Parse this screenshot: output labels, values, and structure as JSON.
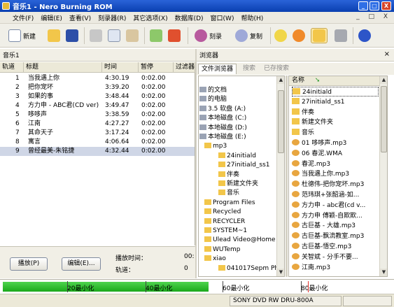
{
  "window": {
    "title": "音乐1 - Nero Burning ROM",
    "controls": [
      "_",
      "□",
      "X"
    ]
  },
  "menu": [
    "文件(F)",
    "编辑(E)",
    "查看(V)",
    "刻录器(R)",
    "其它选项(X)",
    "数据库(D)",
    "窗口(W)",
    "帮助(H)"
  ],
  "mdi_controls": "_ □ X",
  "toolbar": {
    "new_label": "新建",
    "burn_label": "刻录",
    "copy_label": "复制"
  },
  "compilation": {
    "title": "音乐1",
    "columns": [
      "轨道",
      "标题",
      "时间",
      "暂停",
      "过滤器"
    ],
    "tracks": [
      {
        "num": "1",
        "title": "当我遇上你",
        "time": "4:30.19",
        "pause": "0:02.00"
      },
      {
        "num": "2",
        "title": "把你宠坏",
        "time": "3:39.20",
        "pause": "0:02.00"
      },
      {
        "num": "3",
        "title": "如果的事",
        "time": "3:48.44",
        "pause": "0:02.00"
      },
      {
        "num": "4",
        "title": "方力申 - ABC君(CD ver)",
        "time": "3:49.47",
        "pause": "0:02.00"
      },
      {
        "num": "5",
        "title": "哆哆声",
        "time": "3:38.59",
        "pause": "0:02.00"
      },
      {
        "num": "6",
        "title": "江南",
        "time": "4:27.27",
        "pause": "0:02.00"
      },
      {
        "num": "7",
        "title": "其命天子",
        "time": "3:17.24",
        "pause": "0:02.00"
      },
      {
        "num": "8",
        "title": "寓言",
        "time": "4:06.64",
        "pause": "0:02.00"
      },
      {
        "num": "9",
        "title": "曾经最美-朱铭捷",
        "time": "4:32.44",
        "pause": "0:02.00"
      }
    ],
    "play_button": "播放(P)",
    "edit_button": "编辑(E)...",
    "play_time_label": "播放时间：",
    "play_time_value": "00:",
    "track_label": "轨道：",
    "track_value": "0"
  },
  "browser": {
    "title": "浏览器",
    "tabs": [
      "文件浏览器",
      "搜索",
      "已存搜索"
    ],
    "tree": [
      {
        "label": "的文档",
        "indent": 0
      },
      {
        "label": "的电脑",
        "indent": 0
      },
      {
        "label": "3.5 软盘 (A:)",
        "indent": 0
      },
      {
        "label": "本地磁盘 (C:)",
        "indent": 0
      },
      {
        "label": "本地磁盘 (D:)",
        "indent": 0
      },
      {
        "label": "本地磁盘 (E:)",
        "indent": 0
      },
      {
        "label": "mp3",
        "indent": 1
      },
      {
        "label": "24initiald",
        "indent": 2
      },
      {
        "label": "27initiald_ss1",
        "indent": 2
      },
      {
        "label": "伴奏",
        "indent": 2
      },
      {
        "label": "新建文件夹",
        "indent": 2
      },
      {
        "label": "音乐",
        "indent": 2
      },
      {
        "label": "Program Files",
        "indent": 1
      },
      {
        "label": "Recycled",
        "indent": 1
      },
      {
        "label": "RECYCLER",
        "indent": 1
      },
      {
        "label": "SYSTEM~1",
        "indent": 1
      },
      {
        "label": "Ulead Video@Home",
        "indent": 1
      },
      {
        "label": "WUTemp",
        "indent": 1
      },
      {
        "label": "xiao",
        "indent": 1
      },
      {
        "label": "041017Sepm Ph...",
        "indent": 2
      }
    ],
    "list_header": "名称",
    "files": [
      {
        "name": "24initiald",
        "type": "folder"
      },
      {
        "name": "27initiald_ss1",
        "type": "folder"
      },
      {
        "name": "伴奏",
        "type": "folder"
      },
      {
        "name": "新建文件夹",
        "type": "folder"
      },
      {
        "name": "音乐",
        "type": "folder"
      },
      {
        "name": "01 哆哆声.mp3",
        "type": "audio"
      },
      {
        "name": "06 春泥.WMA",
        "type": "audio"
      },
      {
        "name": "春泥.mp3",
        "type": "audio"
      },
      {
        "name": "当我遇上你.mp3",
        "type": "audio"
      },
      {
        "name": "杜德伟-把你宠坏.mp3",
        "type": "audio"
      },
      {
        "name": "范玮琪+张韶涵-如...",
        "type": "audio"
      },
      {
        "name": "方力申 - abc君(cd v...",
        "type": "audio"
      },
      {
        "name": "方力申 傅颖-自欺欺...",
        "type": "audio"
      },
      {
        "name": "古巨基 - 大雄.mp3",
        "type": "audio"
      },
      {
        "name": "古巨基-飘流教室.mp3",
        "type": "audio"
      },
      {
        "name": "古巨基-悟空.mp3",
        "type": "audio"
      },
      {
        "name": "关智斌 - 分手不要...",
        "type": "audio"
      },
      {
        "name": "江南.mp3",
        "type": "audio"
      }
    ]
  },
  "capacity": {
    "fill_fraction": 0.545,
    "markers": [
      "20最小化",
      "40最小化",
      "60最小化",
      "80最小化"
    ]
  },
  "status": {
    "drive": "SONY    DVD RW DRU-800A"
  },
  "colors": {
    "title_bar": "#0a3fb0",
    "capacity_fill": "#1aa81a",
    "selected_row": "#cfd6e6"
  }
}
